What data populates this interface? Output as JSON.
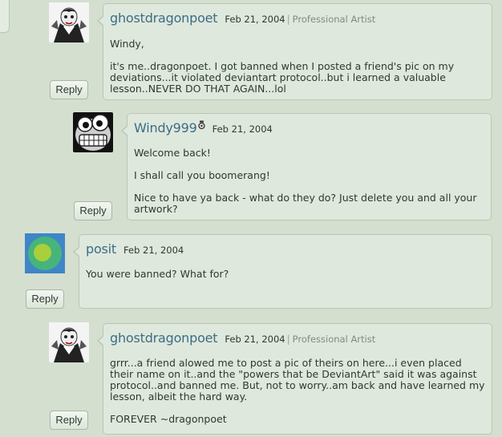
{
  "comments": [
    {
      "username": "ghostdragonpoet",
      "date": "Feb 21, 2004",
      "role": "Professional Artist",
      "paragraphs": [
        "Windy,",
        "it's me..dragonpoet. I got banned when I posted a friend's pic on my deviations...it violated deviantart protocol..but i learned a valuable lesson..NEVER DO THAT AGAIN...lol"
      ],
      "reply_label": "Reply",
      "avatar": "vampire-cartoon-avatar"
    },
    {
      "username": "Windy999",
      "date": "Feb 21, 2004",
      "badge": "deviant-badge-icon",
      "paragraphs": [
        "Welcome back!",
        "I shall call you boomerang!",
        "Nice to have ya back - what do they do? Just delete you and all your artwork?"
      ],
      "reply_label": "Reply",
      "avatar": "grimacing-face-avatar"
    },
    {
      "username": "posit",
      "date": "Feb 21, 2004",
      "paragraphs": [
        "You were banned? What for?"
      ],
      "reply_label": "Reply",
      "avatar": "green-circle-avatar"
    },
    {
      "username": "ghostdragonpoet",
      "date": "Feb 21, 2004",
      "role": "Professional Artist",
      "paragraphs": [
        "grrr...a friend alowed me to post a pic of theirs on here...i even placed their name on it..and the \"powers that be DeviantArt\" said it was against protocol..and banned me. But, not to worry..am back and have learned my lesson, albeit the hard way.",
        "FOREVER ~dragonpoet"
      ],
      "reply_label": "Reply",
      "avatar": "vampire-cartoon-avatar"
    }
  ],
  "colors": {
    "background": "#d4dfd0",
    "bubble": "#dfe8dc",
    "username": "#3a6e86",
    "role": "#7d8d7f"
  }
}
